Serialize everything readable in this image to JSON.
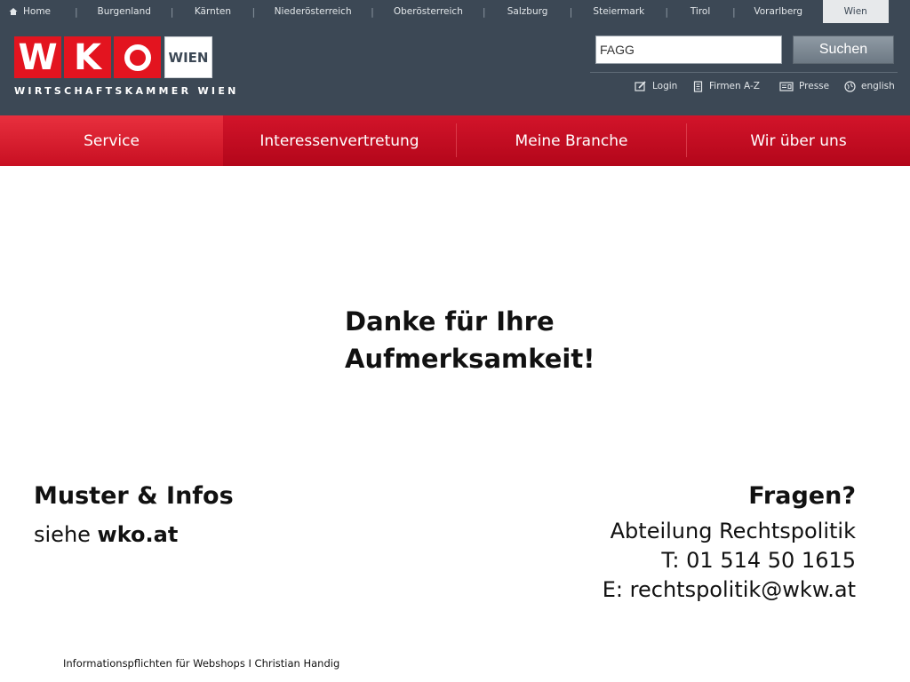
{
  "topnav": {
    "items": [
      "Home",
      "Burgenland",
      "Kärnten",
      "Niederösterreich",
      "Oberösterreich",
      "Salzburg",
      "Steiermark",
      "Tirol",
      "Vorarlberg",
      "Wien"
    ],
    "active": "Wien"
  },
  "logo": {
    "letters": [
      "W",
      "K",
      "O"
    ],
    "region": "WIEN",
    "tagline": "WIRTSCHAFTSKAMMER WIEN"
  },
  "search": {
    "value": "FAGG",
    "button_label": "Suchen"
  },
  "utility": {
    "login": "Login",
    "firmen": "Firmen A-Z",
    "presse": "Presse",
    "english": "english"
  },
  "mainnav": {
    "tabs": [
      "Service",
      "Interessenvertretung",
      "Meine Branche",
      "Wir über uns"
    ],
    "active": "Service"
  },
  "content": {
    "thanks_line1": "Danke für Ihre",
    "thanks_line2": "Aufmerksamkeit!",
    "left_heading": "Muster & Infos",
    "left_text": "siehe ",
    "left_link": "wko.at",
    "right_heading": "Fragen?",
    "right_line1": "Abteilung Rechtspolitik",
    "right_line2": "T: 01 514 50 1615",
    "right_line3": "E: rechtspolitik@wkw.at"
  },
  "footer": "Informationspflichten für Webshops I  Christian Handig",
  "colors": {
    "brand_red": "#e3141f",
    "header_slate": "#3c4855",
    "nav_red": "#c40c22"
  }
}
